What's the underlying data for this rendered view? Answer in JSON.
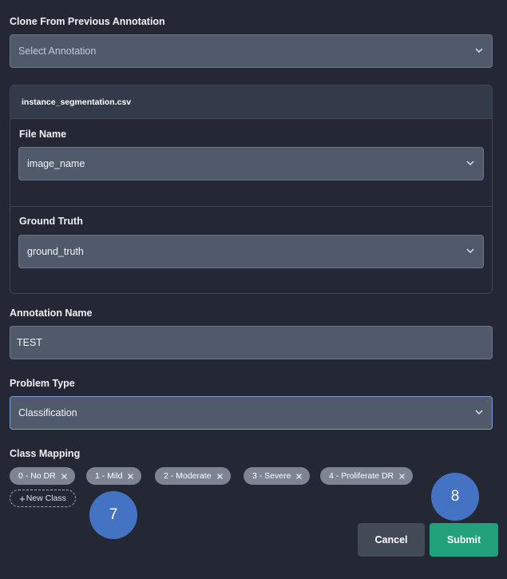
{
  "clone": {
    "label": "Clone From Previous Annotation",
    "placeholder": "Select Annotation"
  },
  "file_card": {
    "title": "instance_segmentation.csv",
    "file_name": {
      "label": "File Name",
      "value": "image_name"
    },
    "ground_truth": {
      "label": "Ground Truth",
      "value": "ground_truth"
    }
  },
  "annotation_name": {
    "label": "Annotation Name",
    "value": "TEST"
  },
  "problem_type": {
    "label": "Problem Type",
    "value": "Classification"
  },
  "class_mapping": {
    "label": "Class Mapping",
    "classes": [
      "0 - No DR",
      "1 - Mild",
      "2 - Moderate",
      "3 - Severe",
      "4 - Proliferate DR"
    ],
    "new_class_label": "New Class"
  },
  "badges": {
    "seven": "7",
    "eight": "8"
  },
  "actions": {
    "cancel": "Cancel",
    "submit": "Submit"
  },
  "colors": {
    "background": "#232834",
    "field": "#515a6b",
    "chip": "#7d8594",
    "badge": "#4573c4",
    "submit": "#22a17a",
    "cancel": "#424957"
  }
}
